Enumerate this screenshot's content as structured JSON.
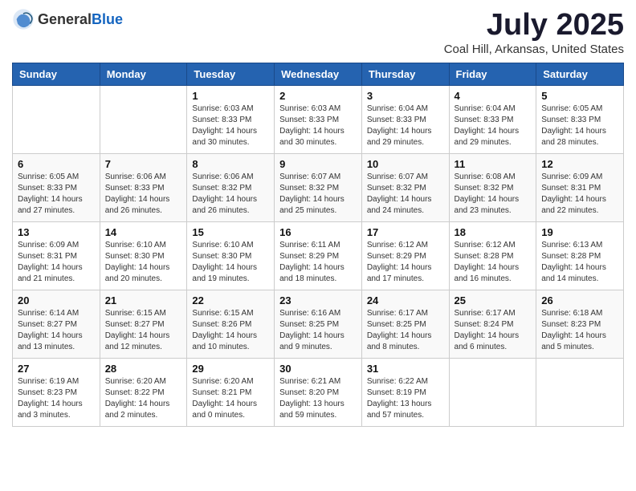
{
  "header": {
    "logo_general": "General",
    "logo_blue": "Blue",
    "title": "July 2025",
    "subtitle": "Coal Hill, Arkansas, United States"
  },
  "weekdays": [
    "Sunday",
    "Monday",
    "Tuesday",
    "Wednesday",
    "Thursday",
    "Friday",
    "Saturday"
  ],
  "weeks": [
    [
      {
        "day": "",
        "info": ""
      },
      {
        "day": "",
        "info": ""
      },
      {
        "day": "1",
        "info": "Sunrise: 6:03 AM\nSunset: 8:33 PM\nDaylight: 14 hours and 30 minutes."
      },
      {
        "day": "2",
        "info": "Sunrise: 6:03 AM\nSunset: 8:33 PM\nDaylight: 14 hours and 30 minutes."
      },
      {
        "day": "3",
        "info": "Sunrise: 6:04 AM\nSunset: 8:33 PM\nDaylight: 14 hours and 29 minutes."
      },
      {
        "day": "4",
        "info": "Sunrise: 6:04 AM\nSunset: 8:33 PM\nDaylight: 14 hours and 29 minutes."
      },
      {
        "day": "5",
        "info": "Sunrise: 6:05 AM\nSunset: 8:33 PM\nDaylight: 14 hours and 28 minutes."
      }
    ],
    [
      {
        "day": "6",
        "info": "Sunrise: 6:05 AM\nSunset: 8:33 PM\nDaylight: 14 hours and 27 minutes."
      },
      {
        "day": "7",
        "info": "Sunrise: 6:06 AM\nSunset: 8:33 PM\nDaylight: 14 hours and 26 minutes."
      },
      {
        "day": "8",
        "info": "Sunrise: 6:06 AM\nSunset: 8:32 PM\nDaylight: 14 hours and 26 minutes."
      },
      {
        "day": "9",
        "info": "Sunrise: 6:07 AM\nSunset: 8:32 PM\nDaylight: 14 hours and 25 minutes."
      },
      {
        "day": "10",
        "info": "Sunrise: 6:07 AM\nSunset: 8:32 PM\nDaylight: 14 hours and 24 minutes."
      },
      {
        "day": "11",
        "info": "Sunrise: 6:08 AM\nSunset: 8:32 PM\nDaylight: 14 hours and 23 minutes."
      },
      {
        "day": "12",
        "info": "Sunrise: 6:09 AM\nSunset: 8:31 PM\nDaylight: 14 hours and 22 minutes."
      }
    ],
    [
      {
        "day": "13",
        "info": "Sunrise: 6:09 AM\nSunset: 8:31 PM\nDaylight: 14 hours and 21 minutes."
      },
      {
        "day": "14",
        "info": "Sunrise: 6:10 AM\nSunset: 8:30 PM\nDaylight: 14 hours and 20 minutes."
      },
      {
        "day": "15",
        "info": "Sunrise: 6:10 AM\nSunset: 8:30 PM\nDaylight: 14 hours and 19 minutes."
      },
      {
        "day": "16",
        "info": "Sunrise: 6:11 AM\nSunset: 8:29 PM\nDaylight: 14 hours and 18 minutes."
      },
      {
        "day": "17",
        "info": "Sunrise: 6:12 AM\nSunset: 8:29 PM\nDaylight: 14 hours and 17 minutes."
      },
      {
        "day": "18",
        "info": "Sunrise: 6:12 AM\nSunset: 8:28 PM\nDaylight: 14 hours and 16 minutes."
      },
      {
        "day": "19",
        "info": "Sunrise: 6:13 AM\nSunset: 8:28 PM\nDaylight: 14 hours and 14 minutes."
      }
    ],
    [
      {
        "day": "20",
        "info": "Sunrise: 6:14 AM\nSunset: 8:27 PM\nDaylight: 14 hours and 13 minutes."
      },
      {
        "day": "21",
        "info": "Sunrise: 6:15 AM\nSunset: 8:27 PM\nDaylight: 14 hours and 12 minutes."
      },
      {
        "day": "22",
        "info": "Sunrise: 6:15 AM\nSunset: 8:26 PM\nDaylight: 14 hours and 10 minutes."
      },
      {
        "day": "23",
        "info": "Sunrise: 6:16 AM\nSunset: 8:25 PM\nDaylight: 14 hours and 9 minutes."
      },
      {
        "day": "24",
        "info": "Sunrise: 6:17 AM\nSunset: 8:25 PM\nDaylight: 14 hours and 8 minutes."
      },
      {
        "day": "25",
        "info": "Sunrise: 6:17 AM\nSunset: 8:24 PM\nDaylight: 14 hours and 6 minutes."
      },
      {
        "day": "26",
        "info": "Sunrise: 6:18 AM\nSunset: 8:23 PM\nDaylight: 14 hours and 5 minutes."
      }
    ],
    [
      {
        "day": "27",
        "info": "Sunrise: 6:19 AM\nSunset: 8:23 PM\nDaylight: 14 hours and 3 minutes."
      },
      {
        "day": "28",
        "info": "Sunrise: 6:20 AM\nSunset: 8:22 PM\nDaylight: 14 hours and 2 minutes."
      },
      {
        "day": "29",
        "info": "Sunrise: 6:20 AM\nSunset: 8:21 PM\nDaylight: 14 hours and 0 minutes."
      },
      {
        "day": "30",
        "info": "Sunrise: 6:21 AM\nSunset: 8:20 PM\nDaylight: 13 hours and 59 minutes."
      },
      {
        "day": "31",
        "info": "Sunrise: 6:22 AM\nSunset: 8:19 PM\nDaylight: 13 hours and 57 minutes."
      },
      {
        "day": "",
        "info": ""
      },
      {
        "day": "",
        "info": ""
      }
    ]
  ]
}
